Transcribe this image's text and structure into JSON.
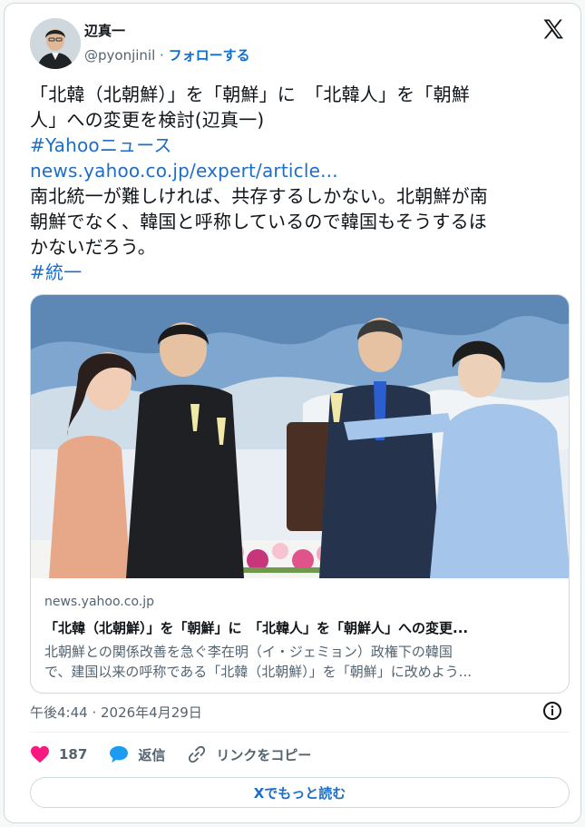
{
  "author": {
    "name": "辺真一",
    "handle": "@pyonjinil",
    "separator": "·",
    "follow_label": "フォローする"
  },
  "logo": {
    "icon": "x-logo-icon"
  },
  "post": {
    "line1": "「北韓（北朝鮮）」を「朝鮮」に　「北韓人」を「朝鮮",
    "line2": "人」への変更を検討(辺真一)",
    "hashtag1": "#Yahooニュース",
    "url": "news.yahoo.co.jp/expert/article...",
    "line3": "南北統一が難しければ、共存するしかない。北朝鮮が南",
    "line4": "朝鮮でなく、韓国と呼称しているので韓国もそうするほ",
    "line5": "かないだろう。",
    "hashtag2": "#統一"
  },
  "link_preview": {
    "domain": "news.yahoo.co.jp",
    "title": "「北韓（北朝鮮）」を「朝鮮」に　「北韓人」を「朝鮮人」への変更...",
    "desc_line1": "北朝鮮との関係改善を急ぐ李在明（イ・ジェミョン）政権下の韓国",
    "desc_line2": "で、建国以来の呼称である「北韓（北朝鮮）」を「朝鮮」に改めよう..."
  },
  "timestamp": "午後4:44 · 2026年4月29日",
  "actions": {
    "likes": "187",
    "reply_label": "返信",
    "copy_link_label": "リンクをコピー"
  },
  "read_more_label": "Xでもっと読む",
  "colors": {
    "link": "#1d6ec7",
    "like": "#f91880",
    "reply": "#1d9bf0"
  }
}
